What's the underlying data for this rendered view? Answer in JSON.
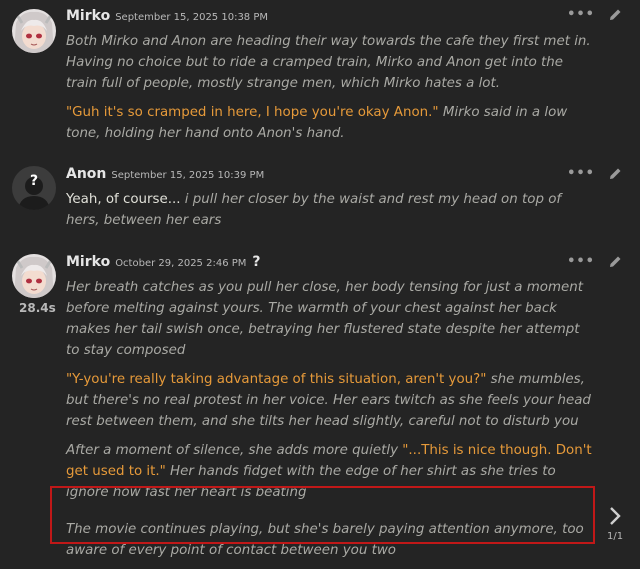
{
  "messages": [
    {
      "name": "Mirko",
      "timestamp": "September 15, 2025 10:38 PM",
      "paragraphs": [
        [
          {
            "t": "it",
            "text": "Both Mirko and Anon are heading their way towards the cafe they first met in. Having no choice but to ride a cramped train, Mirko and Anon get into the train full of people, mostly strange men, which Mirko hates a lot."
          }
        ],
        [
          {
            "t": "q",
            "text": "\"Guh it's so cramped in here, I hope you're okay Anon.\""
          },
          {
            "t": "it",
            "text": " Mirko said in a low tone, holding her hand onto Anon's hand."
          }
        ]
      ]
    },
    {
      "name": "Anon",
      "timestamp": "September 15, 2025 10:39 PM",
      "paragraphs": [
        [
          {
            "t": "plain",
            "text": "Yeah, of course... "
          },
          {
            "t": "it",
            "text": "i pull her closer by the waist and rest my head on top of hers, between her ears"
          }
        ]
      ]
    },
    {
      "name": "Mirko",
      "timestamp": "October 29, 2025 2:46 PM",
      "timer": "28.4s",
      "question_mark": "?",
      "paragraphs": [
        [
          {
            "t": "it",
            "text": "Her breath catches as you pull her close, her body tensing for just a moment before melting against yours. The warmth of your chest against her back makes her tail swish once, betraying her flustered state despite her attempt to stay composed"
          }
        ],
        [
          {
            "t": "q",
            "text": "\"Y-you're really taking advantage of this situation, aren't you?\""
          },
          {
            "t": "it",
            "text": " she mumbles, but there's no real protest in her voice. Her ears twitch as she feels your head rest between them, and she tilts her head slightly, careful not to disturb you"
          }
        ],
        [
          {
            "t": "it",
            "text": "After a moment of silence, she adds more quietly "
          },
          {
            "t": "q",
            "text": "\"...This is nice though. Don't get used to it.\""
          },
          {
            "t": "it",
            "text": " Her hands fidget with the edge of her shirt as she tries to ignore how fast her heart is beating"
          }
        ],
        [
          {
            "t": "it",
            "text": "The movie continues playing, but she's barely paying attention anymore, too aware of every point of contact between you two"
          }
        ]
      ]
    }
  ],
  "swipe_counter": "1/1",
  "icons": {
    "more": "ellipsis-icon",
    "edit": "pencil-icon",
    "swipe": "chevron-right-icon"
  }
}
